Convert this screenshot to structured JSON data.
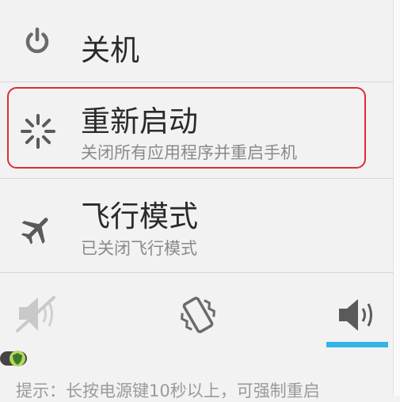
{
  "menu": {
    "power_off": {
      "title": "关机",
      "icon": "power-icon"
    },
    "reboot": {
      "title": "重新启动",
      "subtitle": "关闭所有应用程序并重启手机",
      "icon": "reboot-spinner-icon"
    },
    "airplane": {
      "title": "飞行模式",
      "subtitle": "已关闭飞行模式",
      "icon": "airplane-icon"
    }
  },
  "sound_modes": [
    {
      "name": "silent",
      "icon": "speaker-muted-icon"
    },
    {
      "name": "vibrate",
      "icon": "vibrate-icon"
    },
    {
      "name": "sound_on",
      "icon": "speaker-on-icon",
      "selected": true
    }
  ],
  "hint": {
    "text": "提示：长按电源键10秒以上，可强制重启"
  },
  "colors": {
    "highlight": "#e02a3a",
    "selected_bar": "#33b5e5",
    "background": "#f2f2f2"
  }
}
